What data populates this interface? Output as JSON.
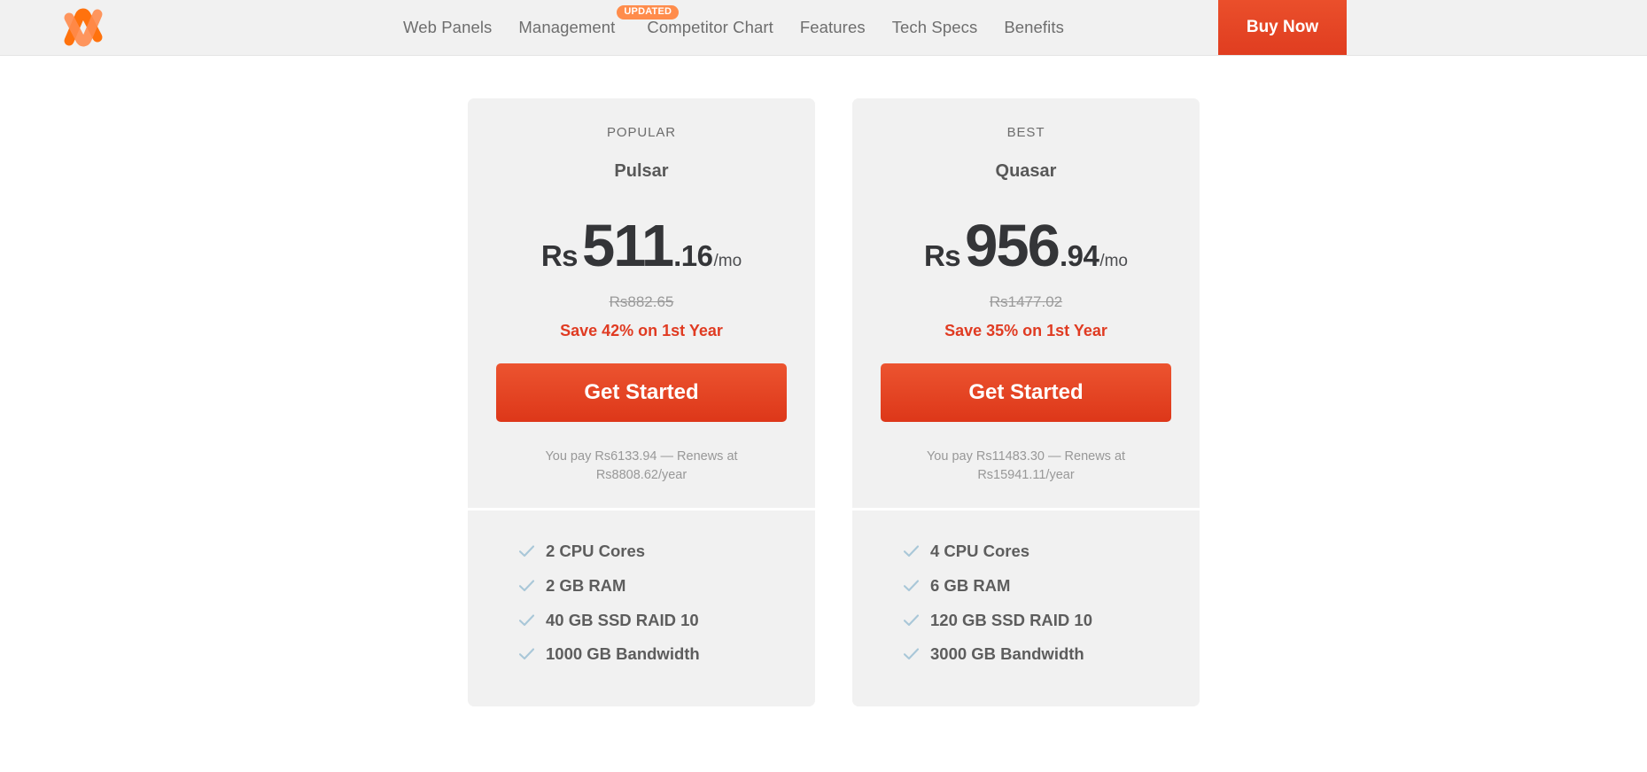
{
  "header": {
    "logo_icon": "namecheap-logo-icon",
    "nav": [
      {
        "label": "Web Panels",
        "badge": null
      },
      {
        "label": "Management",
        "badge": "UPDATED"
      },
      {
        "label": "Competitor Chart",
        "badge": null
      },
      {
        "label": "Features",
        "badge": null
      },
      {
        "label": "Tech Specs",
        "badge": null
      },
      {
        "label": "Benefits",
        "badge": null
      }
    ],
    "buy_now_label": "Buy Now"
  },
  "colors": {
    "accent": "#e03b22",
    "button_gradient_top": "#ec5430",
    "button_gradient_bottom": "#dd3719",
    "badge_orange": "#ff8c4b",
    "card_background": "#f1f1f1",
    "header_background": "#f1f1f1",
    "check_blue": "#a9c7d8"
  },
  "plans": [
    {
      "badge": "POPULAR",
      "name": "Pulsar",
      "currency": "Rs",
      "price_whole": "511",
      "price_cents": ".16",
      "price_period": "/mo",
      "old_price": "Rs882.65",
      "save_text": "Save 42% on 1st Year",
      "cta_label": "Get Started",
      "renew_text": "You pay Rs6133.94 — Renews at Rs8808.62/year",
      "features": [
        "2 CPU Cores",
        "2 GB RAM",
        "40 GB SSD RAID 10",
        "1000 GB Bandwidth"
      ]
    },
    {
      "badge": "BEST",
      "name": "Quasar",
      "currency": "Rs",
      "price_whole": "956",
      "price_cents": ".94",
      "price_period": "/mo",
      "old_price": "Rs1477.02",
      "save_text": "Save 35% on 1st Year",
      "cta_label": "Get Started",
      "renew_text": "You pay Rs11483.30 — Renews at Rs15941.11/year",
      "features": [
        "4 CPU Cores",
        "6 GB RAM",
        "120 GB SSD RAID 10",
        "3000 GB Bandwidth"
      ]
    }
  ]
}
